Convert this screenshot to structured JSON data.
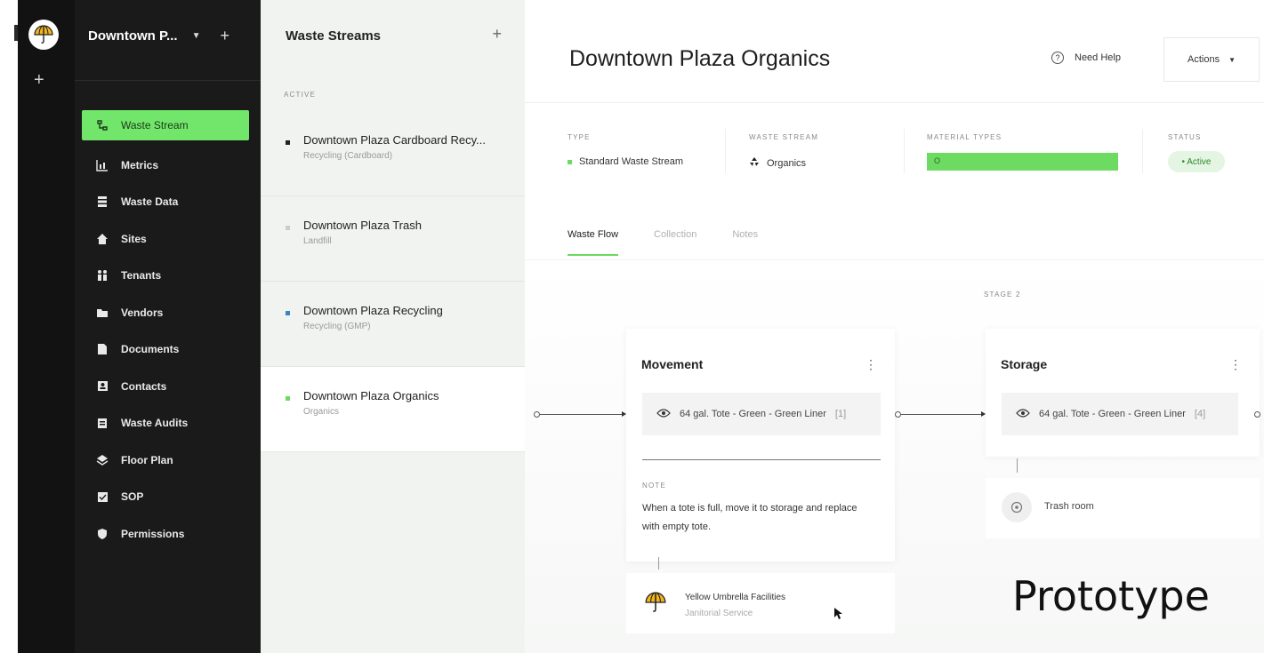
{
  "colors": {
    "accent": "#72e66a",
    "sidebar_bg": "#1a1a1a",
    "rail_bg": "#121212",
    "list_bg": "#f1f3f1"
  },
  "sidebar": {
    "org_name": "Downtown P...",
    "items": [
      {
        "label": "Waste Stream",
        "icon": "waste-stream-icon",
        "active": true
      },
      {
        "label": "Metrics",
        "icon": "metrics-icon"
      },
      {
        "label": "Waste Data",
        "icon": "waste-data-icon"
      },
      {
        "label": "Sites",
        "icon": "home-icon"
      },
      {
        "label": "Tenants",
        "icon": "tenants-icon"
      },
      {
        "label": "Vendors",
        "icon": "folder-icon"
      },
      {
        "label": "Documents",
        "icon": "document-icon"
      },
      {
        "label": "Contacts",
        "icon": "contacts-icon"
      },
      {
        "label": "Waste Audits",
        "icon": "clipboard-icon"
      },
      {
        "label": "Floor Plan",
        "icon": "layers-icon"
      },
      {
        "label": "SOP",
        "icon": "sop-icon"
      },
      {
        "label": "Permissions",
        "icon": "shield-icon"
      }
    ]
  },
  "streams": {
    "header": "Waste Streams",
    "section_label": "ACTIVE",
    "items": [
      {
        "name": "Downtown Plaza Cardboard Recy...",
        "sub": "Recycling (Cardboard)",
        "color": "#222222"
      },
      {
        "name": "Downtown Plaza Trash",
        "sub": "Landfill",
        "color": "#cccccc"
      },
      {
        "name": "Downtown Plaza Recycling",
        "sub": "Recycling (GMP)",
        "color": "#3b82c4"
      },
      {
        "name": "Downtown Plaza Organics",
        "sub": "Organics",
        "color": "#6ddb62",
        "selected": true
      }
    ]
  },
  "main": {
    "title": "Downtown Plaza Organics",
    "help_label": "Need Help",
    "actions_label": "Actions",
    "meta": {
      "type_label": "TYPE",
      "type_value": "Standard Waste Stream",
      "stream_label": "WASTE STREAM",
      "stream_value": "Organics",
      "material_label": "MATERIAL TYPES",
      "material_value": "O",
      "status_label": "STATUS",
      "status_value": "• Active"
    },
    "tabs": [
      "Waste Flow",
      "Collection",
      "Notes"
    ],
    "stage_label": "STAGE 2",
    "movement": {
      "title": "Movement",
      "item": "64 gal. Tote - Green - Green Liner",
      "count": "[1]",
      "note_label": "NOTE",
      "note_text": "When a tote is full, move it to storage and replace with empty tote.",
      "vendor_name": "Yellow Umbrella Facilities",
      "vendor_sub": "Janitorial Service"
    },
    "storage": {
      "title": "Storage",
      "item": "64 gal. Tote - Green - Green Liner",
      "count": "[4]",
      "location": "Trash room"
    }
  },
  "watermark": "Prototype"
}
